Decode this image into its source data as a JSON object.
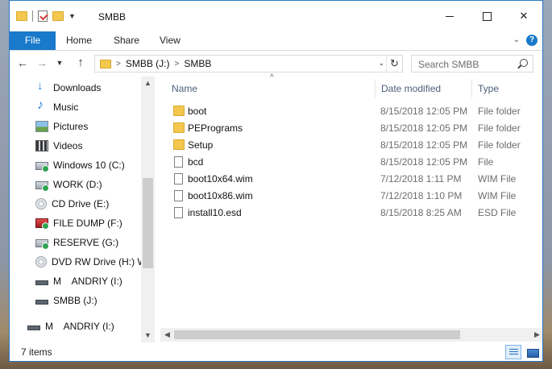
{
  "window": {
    "title": "SMBB"
  },
  "ribbon": {
    "tabs": [
      "File",
      "Home",
      "Share",
      "View"
    ],
    "help": "?"
  },
  "address": {
    "crumbs": [
      "SMBB (J:)",
      "SMBB"
    ]
  },
  "search": {
    "placeholder": "Search SMBB"
  },
  "navpane": {
    "items": [
      {
        "label": "Downloads",
        "icon": "downloads-icon"
      },
      {
        "label": "Music",
        "icon": "music-icon"
      },
      {
        "label": "Pictures",
        "icon": "pictures-icon"
      },
      {
        "label": "Videos",
        "icon": "videos-icon"
      },
      {
        "label": "Windows 10 (C:)",
        "icon": "drive-icon"
      },
      {
        "label": "WORK (D:)",
        "icon": "drive-icon"
      },
      {
        "label": "CD Drive (E:)",
        "icon": "cd-drive-icon"
      },
      {
        "label": "FILE DUMP (F:)",
        "icon": "drive-icon"
      },
      {
        "label": "RESERVE (G:)",
        "icon": "drive-icon"
      },
      {
        "label": "DVD RW Drive (H:) W",
        "icon": "dvd-drive-icon"
      },
      {
        "label": "M    ANDRIY (I:)",
        "icon": "usb-drive-icon"
      },
      {
        "label": "SMBB (J:)",
        "icon": "usb-drive-icon"
      },
      {
        "label": "M    ANDRIY (I:)",
        "icon": "usb-drive-icon"
      }
    ]
  },
  "columns": {
    "name": "Name",
    "date": "Date modified",
    "type": "Type"
  },
  "files": [
    {
      "name": "boot",
      "date": "8/15/2018 12:05 PM",
      "type": "File folder",
      "kind": "folder"
    },
    {
      "name": "PEPrograms",
      "date": "8/15/2018 12:05 PM",
      "type": "File folder",
      "kind": "folder"
    },
    {
      "name": "Setup",
      "date": "8/15/2018 12:05 PM",
      "type": "File folder",
      "kind": "folder"
    },
    {
      "name": "bcd",
      "date": "8/15/2018 12:05 PM",
      "type": "File",
      "kind": "file"
    },
    {
      "name": "boot10x64.wim",
      "date": "7/12/2018 1:11 PM",
      "type": "WIM File",
      "kind": "file"
    },
    {
      "name": "boot10x86.wim",
      "date": "7/12/2018 1:10 PM",
      "type": "WIM File",
      "kind": "file"
    },
    {
      "name": "install10.esd",
      "date": "8/15/2018 8:25 AM",
      "type": "ESD File",
      "kind": "file"
    }
  ],
  "status": {
    "count": "7 items"
  }
}
